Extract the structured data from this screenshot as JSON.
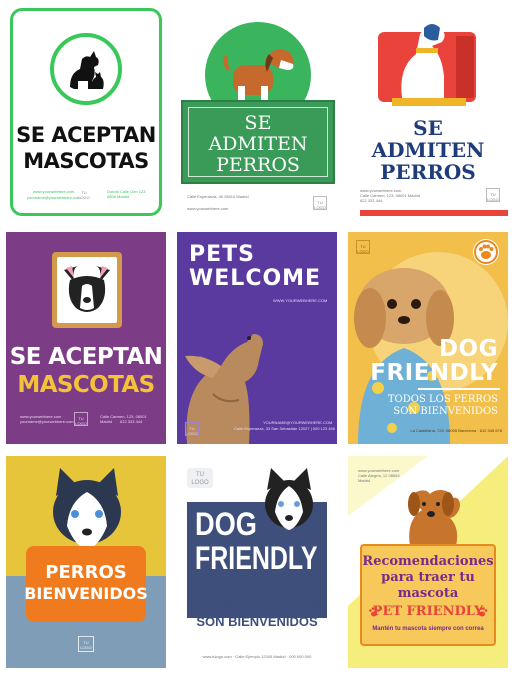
{
  "cards": [
    {
      "title_line1": "SE ACEPTAN",
      "title_line2": "MASCOTAS",
      "web": "www.yourwebhere.com",
      "email": "yourname@yourwebhere.com",
      "logo": "TU LOGO",
      "address": "Donde Calle Gen 123 080# Madrid"
    },
    {
      "title_line1": "SE",
      "title_line2": "ADMITEN",
      "title_line3": "PERROS",
      "address": "Calle Esperanza, 45 28010 Madrid",
      "web": "www.yourwebhere.com",
      "logo": "TU LOGO"
    },
    {
      "title_line1": "SE",
      "title_line2": "ADMITEN",
      "title_line3": "PERROS",
      "web": "www.yourwebhere.com",
      "address": "Calle Carmen, 123, 08001 Madrid",
      "phone": "622 333 444",
      "logo": "TU LOGO"
    },
    {
      "title_line1": "SE ACEPTAN",
      "title_line2": "MASCOTAS",
      "web": "www.yourwebhere.com",
      "email": "yourname@yourwebhere.com",
      "logo": "TU LOGO",
      "address": "Calle Carmen, 123, 08001 Madrid",
      "phone": "622 333 444"
    },
    {
      "title_line1": "PETS",
      "title_line2": "WELCOME",
      "web": "WWW.YOURWEBHERE.COM",
      "email": "YOURNAME@YOURWEBHERE.COM",
      "address": "Calle Esperanza, 33 San Sebastián 12027 | 000 123 456",
      "logo": "TU LOGO"
    },
    {
      "title_line1": "DOG",
      "title_line2": "FRIENDLY",
      "subtitle_line1": "TODOS LOS PERROS",
      "subtitle_line2": "SON BIENVENIDOS",
      "logo": "TU LOGO",
      "address": "La Castellana, 725, 08005 Barcelona · 612 345 678"
    },
    {
      "title_line1": "PERROS",
      "title_line2": "BIENVENIDOS",
      "logo": "TU LOGO"
    },
    {
      "logo": "TU LOGO",
      "title_line1": "DOG",
      "title_line2": "FRIENDLY",
      "subtitle_line1": "TODOS LOS PERROS",
      "subtitle_line2": "SON BIENVENIDOS",
      "footer": "www.tulogo.com · Calle Ejemplo 12345 Madrid · 000 000 000"
    },
    {
      "web": "www.yourwebhere.com",
      "address_line1": "Calle Alegría, 12 08063",
      "address_line2": "Madrid",
      "title_line1": "Recomendaciones",
      "title_line2": "para traer tu",
      "title_line3": "mascota",
      "badge": "PET FRIENDLY",
      "footer": "Mantén tu mascota siempre con correa"
    }
  ],
  "colors": {
    "green": "#3bc85a",
    "dark_green": "#3a9a57",
    "navy": "#1e3b7a",
    "purple": "#7c3c86",
    "violet": "#5b3aa0",
    "orange": "#e98a1f",
    "gold": "#f3b935",
    "slate": "#7f9db7",
    "yellow": "#f6ee7c"
  },
  "icons": [
    "dog-cat-icon",
    "beagle-icon",
    "dog-sitting-icon",
    "dog-sign-icon",
    "paw-icon",
    "husky-icon"
  ]
}
